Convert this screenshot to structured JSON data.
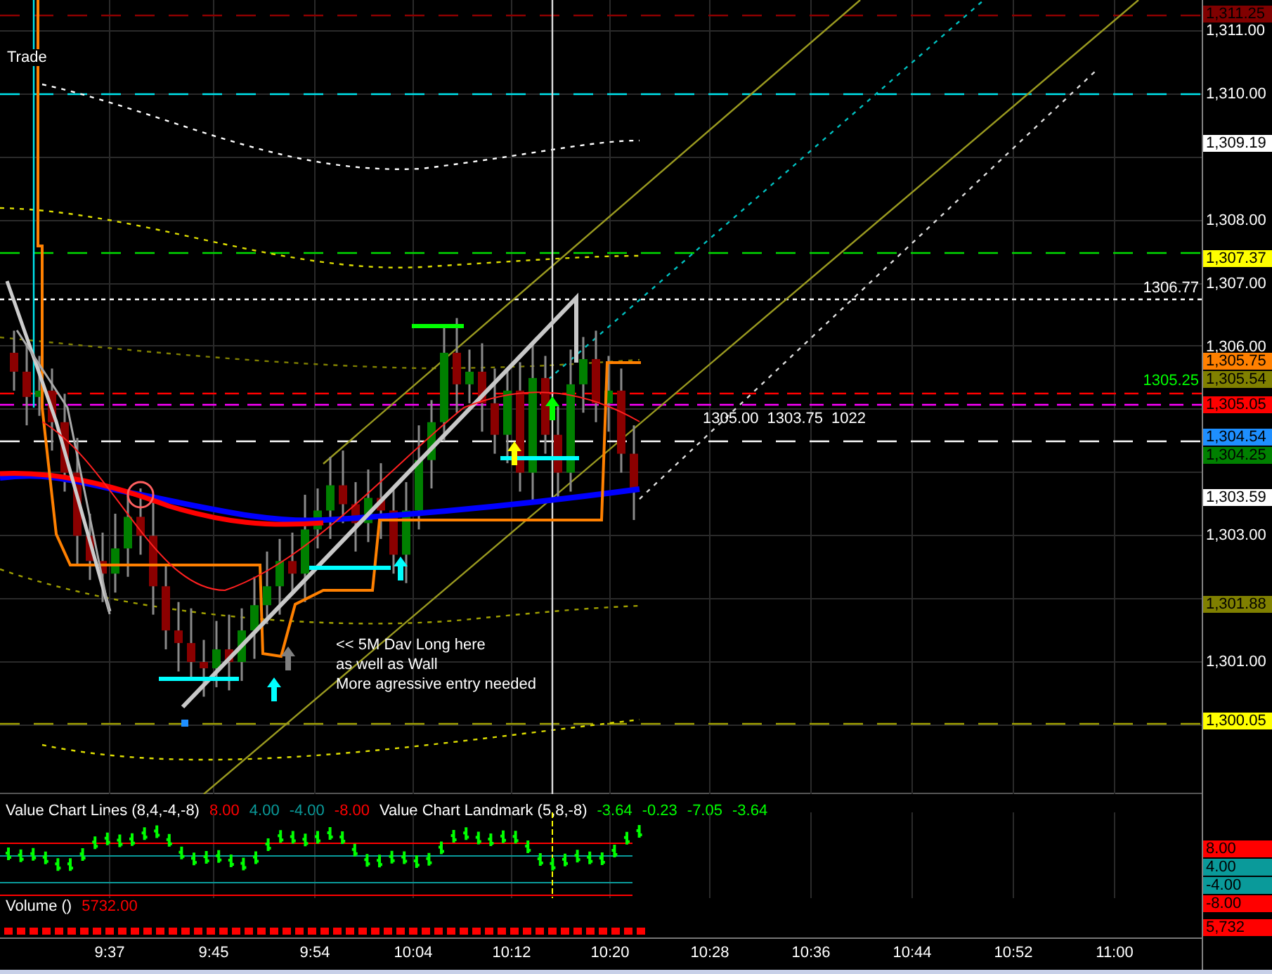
{
  "price_chart": {
    "trade_label": "Trade",
    "line_labels": [
      {
        "text": "1306.77",
        "color": "#ffffff"
      },
      {
        "text": "1305.25",
        "color": "#00ff00"
      }
    ],
    "bar_info": [
      "1305.00",
      "1303.75",
      "1022"
    ],
    "annotation": [
      "<< 5M Dav Long here",
      "as well as Wall",
      "More agressive entry needed"
    ]
  },
  "price_axis": {
    "ticks": [
      "1,311.00",
      "1,310.00",
      "1,308.00",
      "1,307.00",
      "1,306.00",
      "1,303.00",
      "1,301.00"
    ],
    "tags": [
      {
        "text": "1,311.25",
        "color": "#800000"
      },
      {
        "text": "1,309.19",
        "color": "#ffffff"
      },
      {
        "text": "1,307.37",
        "color": "#ffff00"
      },
      {
        "text": "1,305.75",
        "color": "#ff8000"
      },
      {
        "text": "1,305.54",
        "color": "#808000"
      },
      {
        "text": "1,305.05",
        "color": "#ff0000"
      },
      {
        "text": "1,304.54",
        "color": "#1e8fff"
      },
      {
        "text": "1,304.25",
        "color": "#008000"
      },
      {
        "text": "1,303.59",
        "color": "#ffffff"
      },
      {
        "text": "1,301.88",
        "color": "#808000"
      },
      {
        "text": "1,300.05",
        "color": "#ffff00"
      }
    ]
  },
  "value_chart": {
    "legend": [
      {
        "text": "Value Chart Lines (8,4,-4,-8)",
        "color": "#ffffff"
      },
      {
        "text": "8.00",
        "color": "#ff0000"
      },
      {
        "text": "4.00",
        "color": "#0a9a9a"
      },
      {
        "text": "-4.00",
        "color": "#0a9a9a"
      },
      {
        "text": "-8.00",
        "color": "#ff0000"
      },
      {
        "text": "Value Chart Landmark (5,8,-8)",
        "color": "#ffffff"
      },
      {
        "text": "-3.64",
        "color": "#00ff00"
      },
      {
        "text": "-0.23",
        "color": "#00ff00"
      },
      {
        "text": "-7.05",
        "color": "#00ff00"
      },
      {
        "text": "-3.64",
        "color": "#00ff00"
      }
    ],
    "tags": [
      {
        "text": "8.00",
        "color": "#ff0000"
      },
      {
        "text": "4.00",
        "color": "#0a9a9a"
      },
      {
        "text": "-4.00",
        "color": "#0a9a9a"
      },
      {
        "text": "-8.00",
        "color": "#ff0000"
      }
    ]
  },
  "volume": {
    "legend": [
      {
        "text": "Volume ()",
        "color": "#ffffff"
      },
      {
        "text": "5732.00",
        "color": "#ff0000"
      }
    ],
    "tags": [
      {
        "text": "5,732",
        "color": "#ff0000"
      }
    ]
  },
  "time_axis": [
    "9:37",
    "9:45",
    "9:54",
    "10:04",
    "10:12",
    "10:20",
    "10:28",
    "10:36",
    "10:44",
    "10:52",
    "11:00"
  ]
}
